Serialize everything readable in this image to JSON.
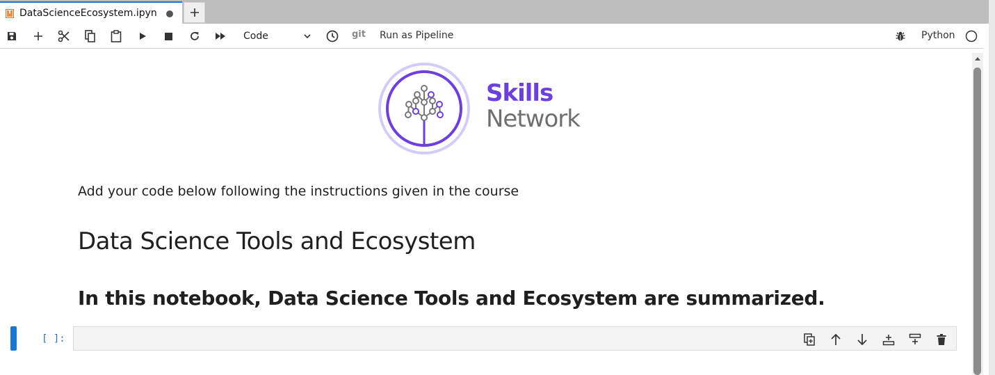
{
  "tab": {
    "title": "DataScienceEcosystem.ipyn",
    "file_icon": "notebook-icon",
    "dirty_icon": "unsaved-dot-icon",
    "new_tab_icon": "plus-icon"
  },
  "toolbar": {
    "cell_type": "Code",
    "git_label": "git",
    "pipeline_label": "Run as Pipeline",
    "kernel_name": "Python",
    "icons": [
      "save-icon",
      "add-cell-icon",
      "cut-icon",
      "copy-icon",
      "paste-icon",
      "run-icon",
      "stop-icon",
      "restart-icon",
      "run-all-icon",
      "history-icon",
      "debug-icon",
      "kernel-status-icon"
    ]
  },
  "notebook": {
    "logo": {
      "line1": "Skills",
      "line2": "Network"
    },
    "instruction": "Add your code below following the instructions given in the course",
    "heading1": "Data Science Tools and Ecosystem",
    "heading2": "In this notebook, Data Science Tools and Ecosystem are summarized.",
    "cell": {
      "prompt": "[ ]:",
      "tools": [
        "duplicate-cell-icon",
        "move-up-icon",
        "move-down-icon",
        "insert-above-icon",
        "insert-below-icon",
        "delete-cell-icon"
      ]
    }
  },
  "colors": {
    "accent": "#1976d2",
    "logo_purple": "#6b3fe0",
    "logo_gray": "#6e6e73"
  }
}
